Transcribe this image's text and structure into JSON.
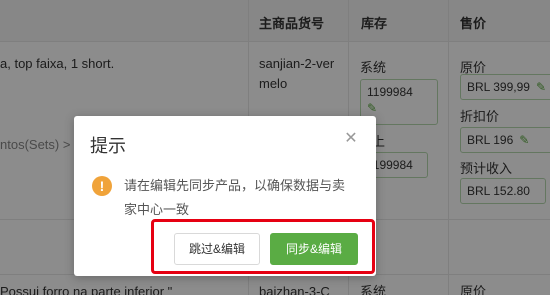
{
  "table": {
    "headers": {
      "main_sku": "主商品货号",
      "stock": "库存",
      "price": "售价"
    },
    "row1": {
      "product_text_1": "a, top faixa, 1 short.",
      "product_text_2": "ntos(Sets) > C",
      "sku_line1": "sanjian-2-ver",
      "sku_line2": "melo",
      "stock_label_system": "系统",
      "stock_value_system": "1199984",
      "stock_label_online": "上",
      "stock_value_online": "1199984",
      "price_label_original": "原价",
      "price_value_original": "BRL 399,99",
      "price_label_discount": "折扣价",
      "price_value_discount": "BRL 196",
      "price_label_estimated": "预计收入",
      "price_value_estimated": "BRL 152.80"
    },
    "row2": {
      "product_text": "Possui forro na parte inferior \"",
      "sku_text": "baizhan-3-C",
      "stock_label": "系统",
      "price_label": "原价"
    }
  },
  "dialog": {
    "title": "提示",
    "close_icon": "close-icon",
    "warning_icon": "warning-icon",
    "message": "请在编辑先同步产品，以确保数据与卖家中心一致",
    "skip_button": "跳过&编辑",
    "sync_button": "同步&编辑"
  },
  "colors": {
    "accent_green": "#5aac44",
    "warning_orange": "#f0a33a",
    "highlight_red": "#e60012"
  }
}
